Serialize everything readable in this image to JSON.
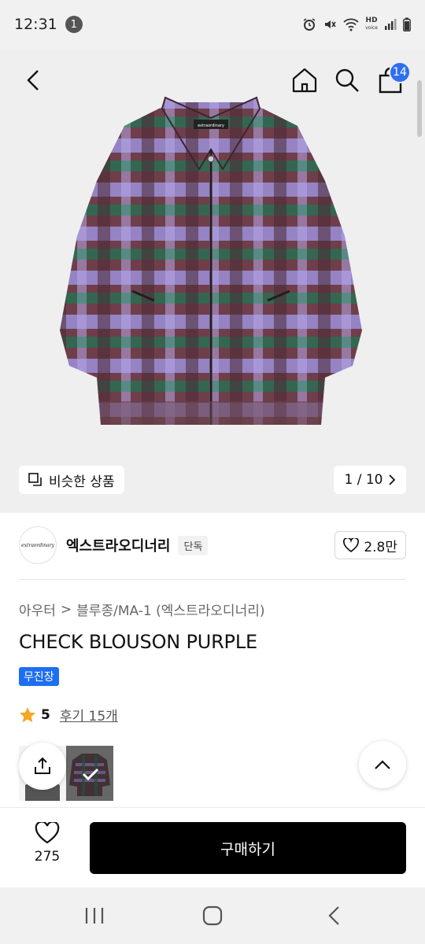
{
  "status_bar": {
    "time": "12:31",
    "notification_count": "1",
    "network_hd": "HD",
    "network_voice": "voice"
  },
  "header": {
    "cart_count": "14"
  },
  "hero": {
    "similar_label": "비슷한 상품",
    "page_indicator": "1 / 10",
    "jacket_brand_tag": "extraordinary"
  },
  "brand": {
    "name": "엑스트라오디너리",
    "logo_text": "extraordinary",
    "exclusive_badge": "단독",
    "likes": "2.8만"
  },
  "breadcrumb": {
    "category": "아우터",
    "separator": ">",
    "subcategory": "블루종/MA-1 (엑스트라오디너리)"
  },
  "product": {
    "title": "CHECK BLOUSON PURPLE",
    "delivery_badge": "무진장",
    "rating": "5",
    "reviews": "후기 15개"
  },
  "action_bar": {
    "wish_count": "275",
    "buy_label": "구매하기"
  },
  "colors": {
    "accent_blue": "#2e6ff2",
    "buy_button": "#000000",
    "star": "#f5a623"
  }
}
